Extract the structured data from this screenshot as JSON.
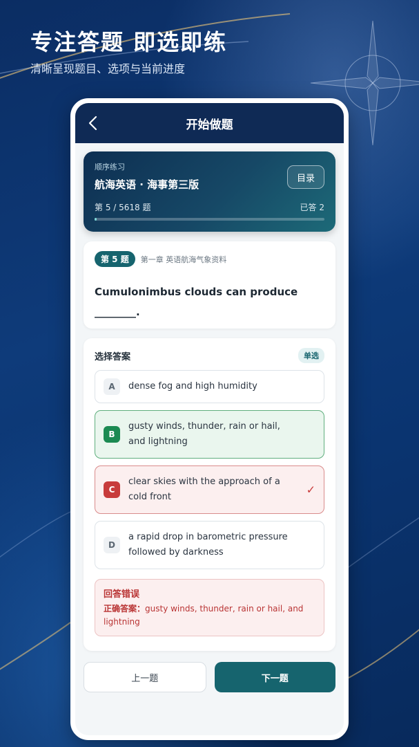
{
  "promo": {
    "title": "专注答题 即选即练",
    "subtitle": "清晰呈现题目、选项与当前进度"
  },
  "nav": {
    "title": "开始做题",
    "back_icon": "chevron-left-icon"
  },
  "practice": {
    "mode": "顺序练习",
    "book": "航海英语 · 海事第三版",
    "directory_label": "目录",
    "progress_text": "第 5 / 5618 题",
    "answered_text": "已答 2",
    "progress_fraction": 0.001
  },
  "question": {
    "badge": "第 5 题",
    "chapter": "第一章 英语航海气象资料",
    "text": "Cumulonimbus clouds can produce ________."
  },
  "answers": {
    "header": "选择答案",
    "type_tag": "单选",
    "options": [
      {
        "letter": "A",
        "text": "dense fog and high humidity",
        "state": "normal"
      },
      {
        "letter": "B",
        "text": "gusty winds, thunder, rain or hail, and lightning",
        "state": "correct"
      },
      {
        "letter": "C",
        "text": "clear skies with the approach of a cold front",
        "state": "wrong"
      },
      {
        "letter": "D",
        "text": "a rapid drop in barometric pressure followed by darkness",
        "state": "normal"
      }
    ],
    "selected_mark": "✓"
  },
  "result": {
    "title": "回答错误",
    "correct_label": "正确答案：",
    "correct_text": "gusty winds, thunder, rain or hail, and lightning"
  },
  "buttons": {
    "prev": "上一题",
    "next": "下一题"
  },
  "colors": {
    "accent": "#16646e",
    "nav_bg": "#0f2a55",
    "correct": "#1b8a52",
    "wrong": "#c83b3b"
  }
}
